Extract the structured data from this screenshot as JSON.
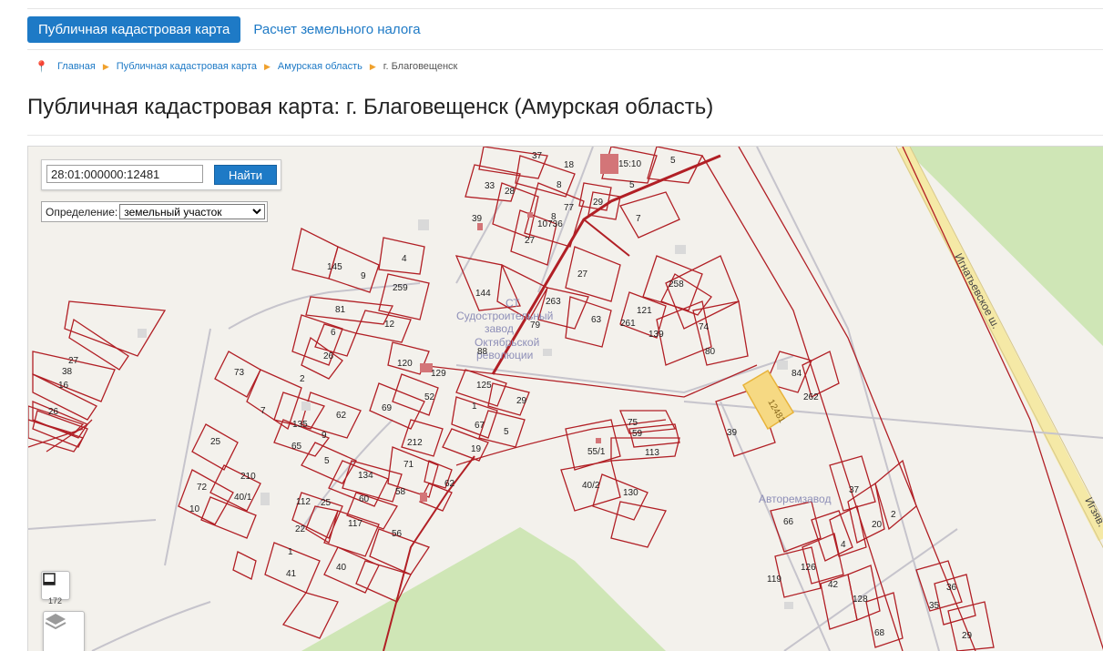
{
  "tabs": {
    "active": "Публичная кадастровая карта",
    "second": "Расчет земельного налога"
  },
  "breadcrumb": [
    "Главная",
    "Публичная кадастровая карта",
    "Амурская область",
    "г. Благовещенск"
  ],
  "page_title": "Публичная кадастровая карта: г. Благовещенск (Амурская область)",
  "map": {
    "search_value": "28:01:000000:12481",
    "search_button": "Найти",
    "definition_label": "Определение:",
    "definition_selected": "земельный участок",
    "labels": {
      "st1": "СТ",
      "st2": "Судостроительный",
      "st3": "завод",
      "st4": "Октябрьской",
      "st5": "революции",
      "road": "Игнатьевское ш.",
      "road2": "Игзяв.",
      "autorepair": "Авторемзавод",
      "selected_parcel": "12481",
      "partial": "172"
    },
    "parcel_numbers": [
      "37",
      "18",
      "15:10",
      "5",
      "33",
      "28",
      "8",
      "29",
      "7",
      "5",
      "39",
      "10736",
      "8",
      "77",
      "27",
      "4",
      "145",
      "9",
      "27",
      "259",
      "144",
      "263",
      "258",
      "81",
      "12",
      "79",
      "63",
      "261",
      "121",
      "139",
      "74",
      "6",
      "80",
      "26",
      "88",
      "120",
      "129",
      "73",
      "2",
      "125",
      "29",
      "52",
      "84",
      "262",
      "7",
      "62",
      "69",
      "1",
      "67",
      "5",
      "75",
      "135",
      "39",
      "59",
      "9",
      "65",
      "212",
      "19",
      "55/1",
      "113",
      "25",
      "5",
      "71",
      "134",
      "40/2",
      "130",
      "210",
      "58",
      "62",
      "72",
      "40/1",
      "60",
      "10",
      "112",
      "25",
      "22",
      "117",
      "56",
      "37",
      "66",
      "2",
      "20",
      "4",
      "1",
      "40",
      "126",
      "119",
      "41",
      "42",
      "128",
      "36",
      "35",
      "68",
      "29",
      "27",
      "38",
      "16",
      "26",
      "18",
      "58"
    ]
  }
}
